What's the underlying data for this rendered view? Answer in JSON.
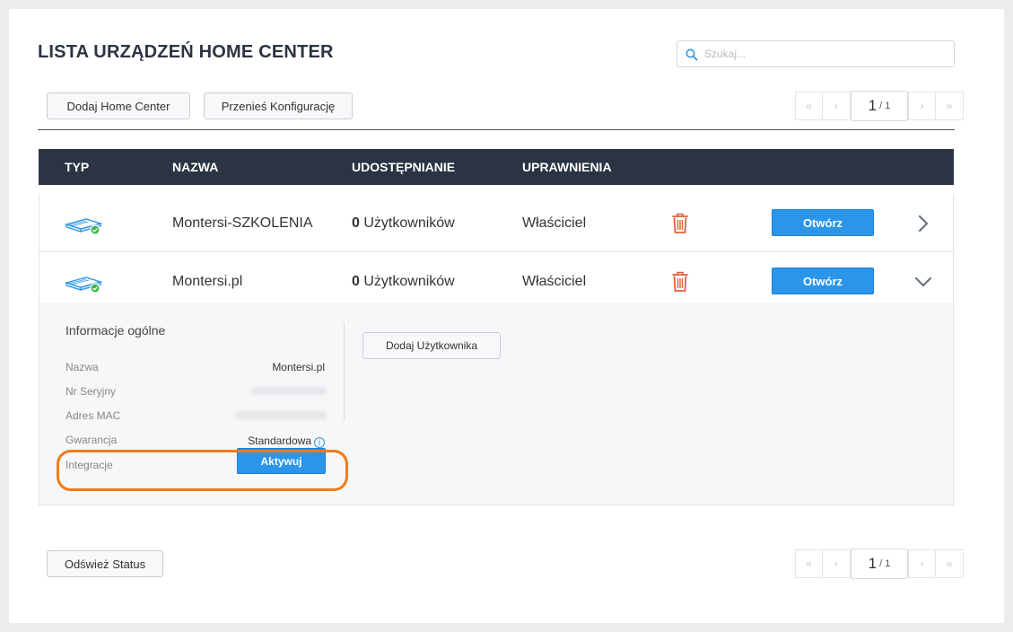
{
  "page": {
    "title": "LISTA URZĄDZEŃ HOME CENTER",
    "search_placeholder": "Szukaj...",
    "buttons": {
      "add_home_center": "Dodaj Home Center",
      "transfer_config": "Przenieś Konfigurację",
      "refresh_status": "Odśwież Status"
    },
    "pagination": {
      "first": "«",
      "prev": "‹",
      "current": "1",
      "total": "/ 1",
      "next": "›",
      "last": "»"
    }
  },
  "table": {
    "headers": {
      "type": "TYP",
      "name": "NAZWA",
      "sharing": "UDOSTĘPNIANIE",
      "permissions": "UPRAWNIENIA"
    },
    "rows": [
      {
        "name": "Montersi-SZKOLENIA",
        "users_count": "0",
        "users_label": "Użytkowników",
        "permission": "Właściciel",
        "open_label": "Otwórz",
        "expanded": false
      },
      {
        "name": "Montersi.pl",
        "users_count": "0",
        "users_label": "Użytkowników",
        "permission": "Właściciel",
        "open_label": "Otwórz",
        "expanded": true
      }
    ]
  },
  "details": {
    "title": "Informacje ogólne",
    "fields": {
      "name_label": "Nazwa",
      "name_value": "Montersi.pl",
      "serial_label": "Nr Seryjny",
      "mac_label": "Adres MAC",
      "warranty_label": "Gwarancja",
      "warranty_value": "Standardowa",
      "integrations_label": "Integracje"
    },
    "activate_label": "Aktywuj",
    "add_user_label": "Dodaj Użytkownika"
  },
  "colors": {
    "header_bg": "#2b3443",
    "primary": "#2b95ea",
    "trash": "#e0603a",
    "highlight": "#f07a1a",
    "online": "#3bb54a"
  }
}
